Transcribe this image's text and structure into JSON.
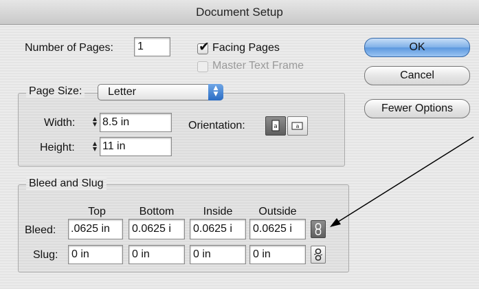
{
  "window": {
    "title": "Document Setup"
  },
  "pages": {
    "label": "Number of Pages:",
    "value": "1",
    "facing_pages": {
      "label": "Facing Pages",
      "checked": true
    },
    "master_text_frame": {
      "label": "Master Text Frame",
      "checked": false,
      "disabled": true
    }
  },
  "buttons": {
    "ok": "OK",
    "cancel": "Cancel",
    "fewer_options": "Fewer Options"
  },
  "page_size": {
    "label": "Page Size:",
    "selected": "Letter",
    "width_label": "Width:",
    "width_value": "8.5 in",
    "height_label": "Height:",
    "height_value": "11 in",
    "orientation_label": "Orientation:"
  },
  "bleed_slug": {
    "title": "Bleed and Slug",
    "columns": [
      "Top",
      "Bottom",
      "Inside",
      "Outside"
    ],
    "bleed_label": "Bleed:",
    "bleed": [
      ".0625 in",
      "0.0625 i",
      "0.0625 i",
      "0.0625 i"
    ],
    "slug_label": "Slug:",
    "slug": [
      "0 in",
      "0 in",
      "0 in",
      "0 in"
    ]
  },
  "icons": {
    "portrait": "portrait-page-icon",
    "landscape": "landscape-page-icon",
    "link": "chain-link-icon",
    "broken_link": "broken-chain-link-icon",
    "checkmark": "checkmark-icon"
  },
  "colors": {
    "default_button": "#5c98de",
    "popup_arrows": "#2a6cc4",
    "pressed_toggle": "#5f5f5f"
  }
}
